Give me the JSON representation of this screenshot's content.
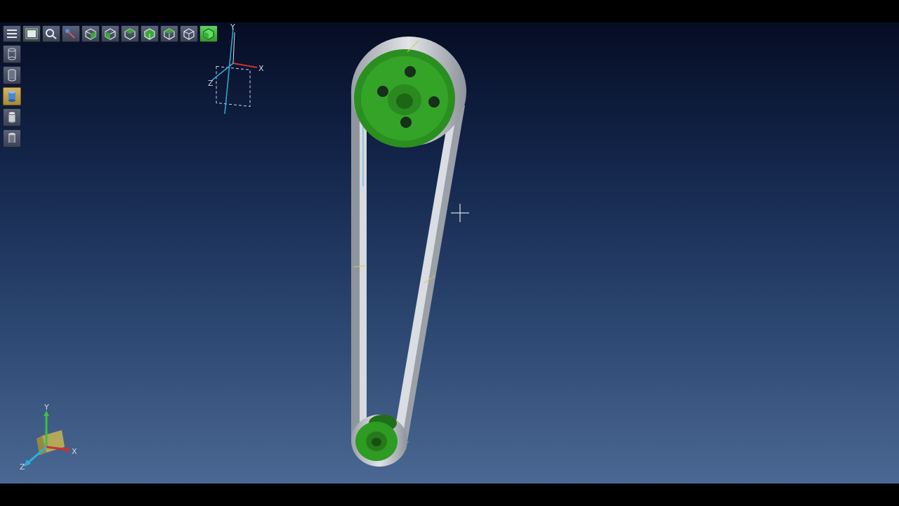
{
  "viewer": {
    "toolbar_top": [
      {
        "name": "menu-button",
        "icon": "menu-icon"
      },
      {
        "name": "fit-view-button",
        "icon": "fit-view-icon"
      },
      {
        "name": "zoom-button",
        "icon": "zoom-icon"
      },
      {
        "name": "rotate-button",
        "icon": "rotate-icon"
      },
      {
        "name": "view-front-button",
        "icon": "cube-front-icon"
      },
      {
        "name": "view-back-button",
        "icon": "cube-back-icon"
      },
      {
        "name": "view-left-button",
        "icon": "cube-left-icon"
      },
      {
        "name": "view-right-button",
        "icon": "cube-right-icon"
      },
      {
        "name": "view-top-button",
        "icon": "cube-top-icon"
      },
      {
        "name": "view-bottom-button",
        "icon": "cube-bottom-icon"
      },
      {
        "name": "view-iso-button",
        "icon": "cube-iso-icon",
        "active": true
      }
    ],
    "toolbar_left": [
      {
        "name": "shading-wireframe-button",
        "icon": "cylinder-wire-icon"
      },
      {
        "name": "shading-hidden-button",
        "icon": "cylinder-hidden-icon"
      },
      {
        "name": "shading-shaded-button",
        "icon": "cylinder-shaded-icon",
        "selected": true
      },
      {
        "name": "shading-edges-button",
        "icon": "cylinder-edges-icon"
      },
      {
        "name": "shading-texture-button",
        "icon": "cylinder-texture-icon"
      }
    ],
    "workplane_triad": {
      "x_label": "X",
      "y_label": "Y",
      "z_label": "Z"
    },
    "corner_triad": {
      "x_label": "X",
      "y_label": "Y",
      "z_label": "Z"
    },
    "colors": {
      "pulley": "#2e9b22",
      "pulley_dark": "#1f6f18",
      "belt": "#c9ccd1",
      "belt_dark": "#8c9198",
      "axis_x": "#d03030",
      "axis_y": "#3fbf3f",
      "axis_z": "#2ab0d8"
    }
  }
}
